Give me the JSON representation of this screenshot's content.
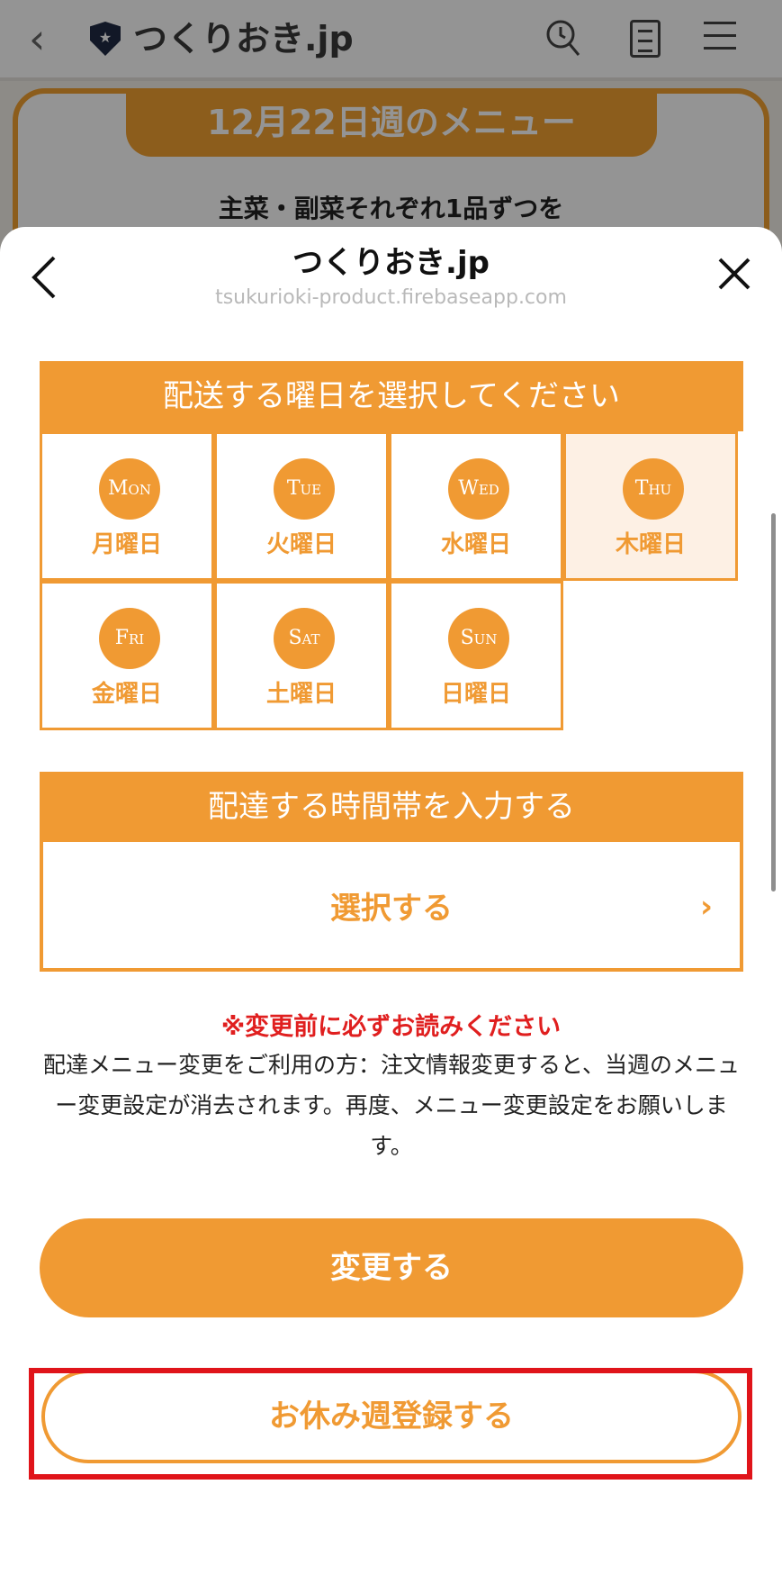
{
  "background_page": {
    "site_name": "つくりおき.jp",
    "shield_glyph": "★",
    "week_title": "12月22日週のメニュー",
    "subtitle": "主菜・副菜それぞれ1品ずつを"
  },
  "sheet": {
    "title": "つくりおき.jp",
    "url": "tsukurioki-product.firebaseapp.com"
  },
  "delivery_day": {
    "heading": "配送する曜日を選択してください",
    "days": [
      {
        "abbr": "Mon",
        "label": "月曜日",
        "selected": false
      },
      {
        "abbr": "Tue",
        "label": "火曜日",
        "selected": false
      },
      {
        "abbr": "Wed",
        "label": "水曜日",
        "selected": false
      },
      {
        "abbr": "Thu",
        "label": "木曜日",
        "selected": true
      },
      {
        "abbr": "Fri",
        "label": "金曜日",
        "selected": false
      },
      {
        "abbr": "Sat",
        "label": "土曜日",
        "selected": false
      },
      {
        "abbr": "Sun",
        "label": "日曜日",
        "selected": false
      }
    ]
  },
  "delivery_time": {
    "heading": "配達する時間帯を入力する",
    "select_label": "選択する",
    "chevron": "›"
  },
  "notice": {
    "title": "※変更前に必ずお読みください",
    "body": "配達メニュー変更をご利用の方：注文情報変更すると、当週のメニュー変更設定が消去されます。再度、メニュー変更設定をお願いします。"
  },
  "buttons": {
    "change": "変更する",
    "skip_week": "お休み週登録する"
  },
  "colors": {
    "accent": "#f09a33",
    "warning": "#e01f1f",
    "selected_bg": "#fdf0e4",
    "highlight_box": "#e0141a"
  }
}
